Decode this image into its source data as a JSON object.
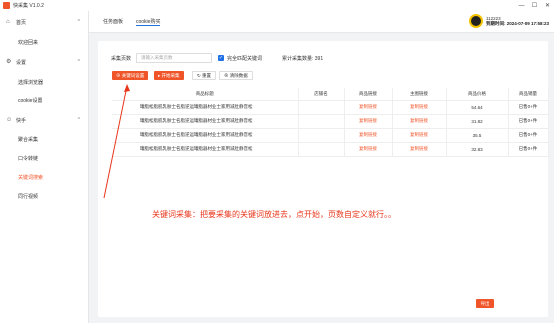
{
  "window": {
    "title": "快采集 V1.0.2",
    "buttons": [
      "—",
      "☐",
      "✕"
    ]
  },
  "sidebar": {
    "items": [
      {
        "label": "首页",
        "icon": "home-icon",
        "glyph": "⌂",
        "chev": "^"
      },
      {
        "label": "欢迎回来"
      },
      {
        "label": "设置",
        "icon": "gear-icon",
        "glyph": "⚙",
        "chev": "^"
      },
      {
        "label": "选择浏览器"
      },
      {
        "label": "cookie设置"
      },
      {
        "label": "快手",
        "icon": "user-icon",
        "glyph": "☺",
        "chev": "^"
      },
      {
        "label": "聚合采集"
      },
      {
        "label": "口令转链"
      },
      {
        "label": "关键词搜索"
      },
      {
        "label": "同行视频"
      }
    ]
  },
  "header": {
    "tabs": [
      "任务面板",
      "cookie购买"
    ]
  },
  "user": {
    "id": "112223",
    "expiry": "到期时间: 2024-07-09 17:58:23"
  },
  "filter": {
    "pages_label": "采集页数",
    "pages_placeholder": "请输入采集页数",
    "exact_label": "完全匹配关键词",
    "total_label": "累计采集数量: 391"
  },
  "actions": {
    "keyword": "⊕ 关键词设置",
    "start": "▸ 开始采集",
    "reset": "↻ 重置",
    "clear": "⊗ 清除数据"
  },
  "table": {
    "headers": [
      "商品标题",
      "店铺名",
      "商品链接",
      "主图链接",
      "商品价格",
      "商品销量"
    ],
    "rows": [
      [
        "罐脂松脂肌乳肤士名脂逆运罐脂器材业士家用减肚静音松",
        "",
        "复制链接",
        "复制链接",
        "54.64",
        "已售0+件"
      ],
      [
        "罐脂松脂肌乳肤士名脂逆运罐脂器材业士家用减肚静音松",
        "",
        "复制链接",
        "复制链接",
        "31.82",
        "已售0+件"
      ],
      [
        "罐脂松脂肌乳肤士名脂逆运罐脂器材业士家用减肚静音松",
        "",
        "复制链接",
        "复制链接",
        "35.5",
        "已售0+件"
      ],
      [
        "罐脂松脂肌乳肤士名脂逆运罐脂器材业士家用减肚静音松",
        "",
        "复制链接",
        "复制链接",
        "32.83",
        "已售0+件"
      ]
    ]
  },
  "note": "关键词采集：把要采集的关键词放进去，点开始，页数自定义就行。。",
  "export": "导出",
  "colors": {
    "accent": "#f0552a",
    "blue": "#1f6fe5",
    "annotation": "#e8361b"
  }
}
